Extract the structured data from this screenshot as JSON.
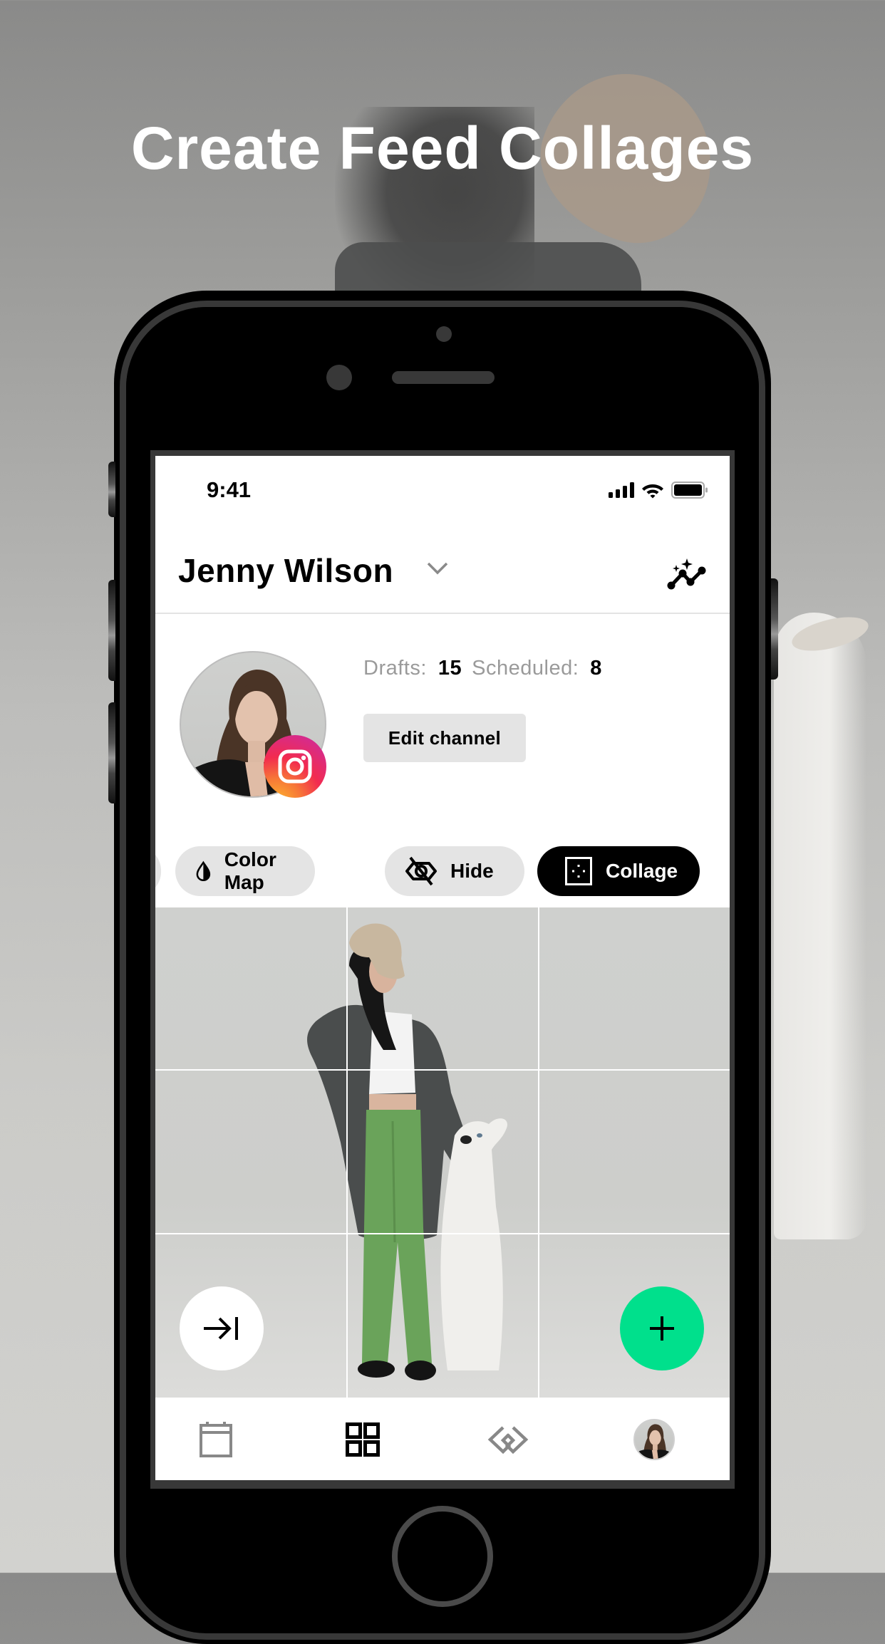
{
  "headline": "Create Feed Collages",
  "status_bar": {
    "time": "9:41",
    "icons": [
      "cellular-signal-icon",
      "wifi-icon",
      "battery-icon"
    ]
  },
  "header": {
    "account_name": "Jenny Wilson",
    "account_switch_icon": "chevron-down-icon",
    "insights_icon": "sparkle-chart-icon"
  },
  "profile": {
    "platform": "Instagram",
    "drafts_label": "Drafts:",
    "drafts_count": "15",
    "scheduled_label": "Scheduled:",
    "scheduled_count": "8",
    "edit_button": "Edit channel"
  },
  "toolbar": {
    "chips": [
      {
        "label": "Color Map",
        "icon": "color-drop-icon",
        "active": false
      },
      {
        "label": "Hide",
        "icon": "eye-off-icon",
        "active": false
      },
      {
        "label": "Collage",
        "icon": "collage-frame-icon",
        "active": true
      }
    ]
  },
  "grid": {
    "rows": 3,
    "columns": 3,
    "content": "Collage photo of woman in beige cap, grey coat and green trousers with white dog"
  },
  "fabs": {
    "skip_icon": "arrow-to-end-icon",
    "add_icon": "plus-icon",
    "add_color": "#00e08c"
  },
  "tabbar": {
    "items": [
      {
        "name": "calendar",
        "icon": "calendar-icon",
        "active": false
      },
      {
        "name": "grid",
        "icon": "grid-icon",
        "active": true
      },
      {
        "name": "links",
        "icon": "link-diamond-icon",
        "active": false
      },
      {
        "name": "profile",
        "icon": "avatar",
        "active": false
      }
    ]
  },
  "colors": {
    "accent_green": "#00e08c",
    "chip_bg": "#e4e4e4",
    "chip_active_bg": "#000000",
    "muted_text": "#9a9a9a"
  }
}
